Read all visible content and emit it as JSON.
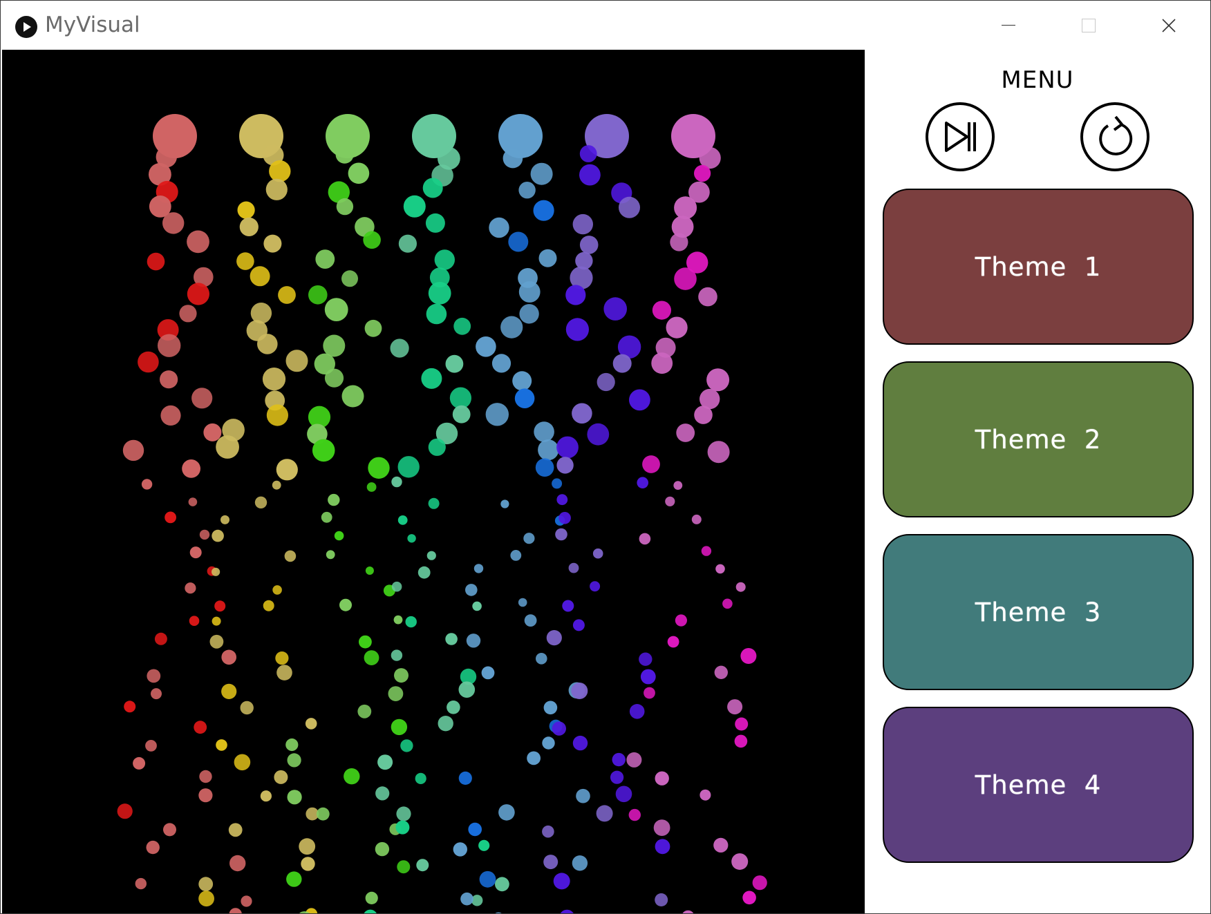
{
  "window": {
    "title": "MyVisual"
  },
  "menu": {
    "title": "MENU",
    "skip_icon": "skip-forward-icon",
    "reset_icon": "reset-icon",
    "themes": [
      {
        "label": "Theme  1",
        "color": "#7b3f3f"
      },
      {
        "label": "Theme  2",
        "color": "#607e3f"
      },
      {
        "label": "Theme  3",
        "color": "#417b7b"
      },
      {
        "label": "Theme  4",
        "color": "#5c3f7e"
      }
    ]
  },
  "visual": {
    "background": "#000000",
    "columns": [
      {
        "color": "#d06464"
      },
      {
        "color": "#cdbb60"
      },
      {
        "color": "#80cc60"
      },
      {
        "color": "#66c99d"
      },
      {
        "color": "#62a0cf"
      },
      {
        "color": "#8066cc"
      },
      {
        "color": "#cb66bf"
      }
    ]
  }
}
